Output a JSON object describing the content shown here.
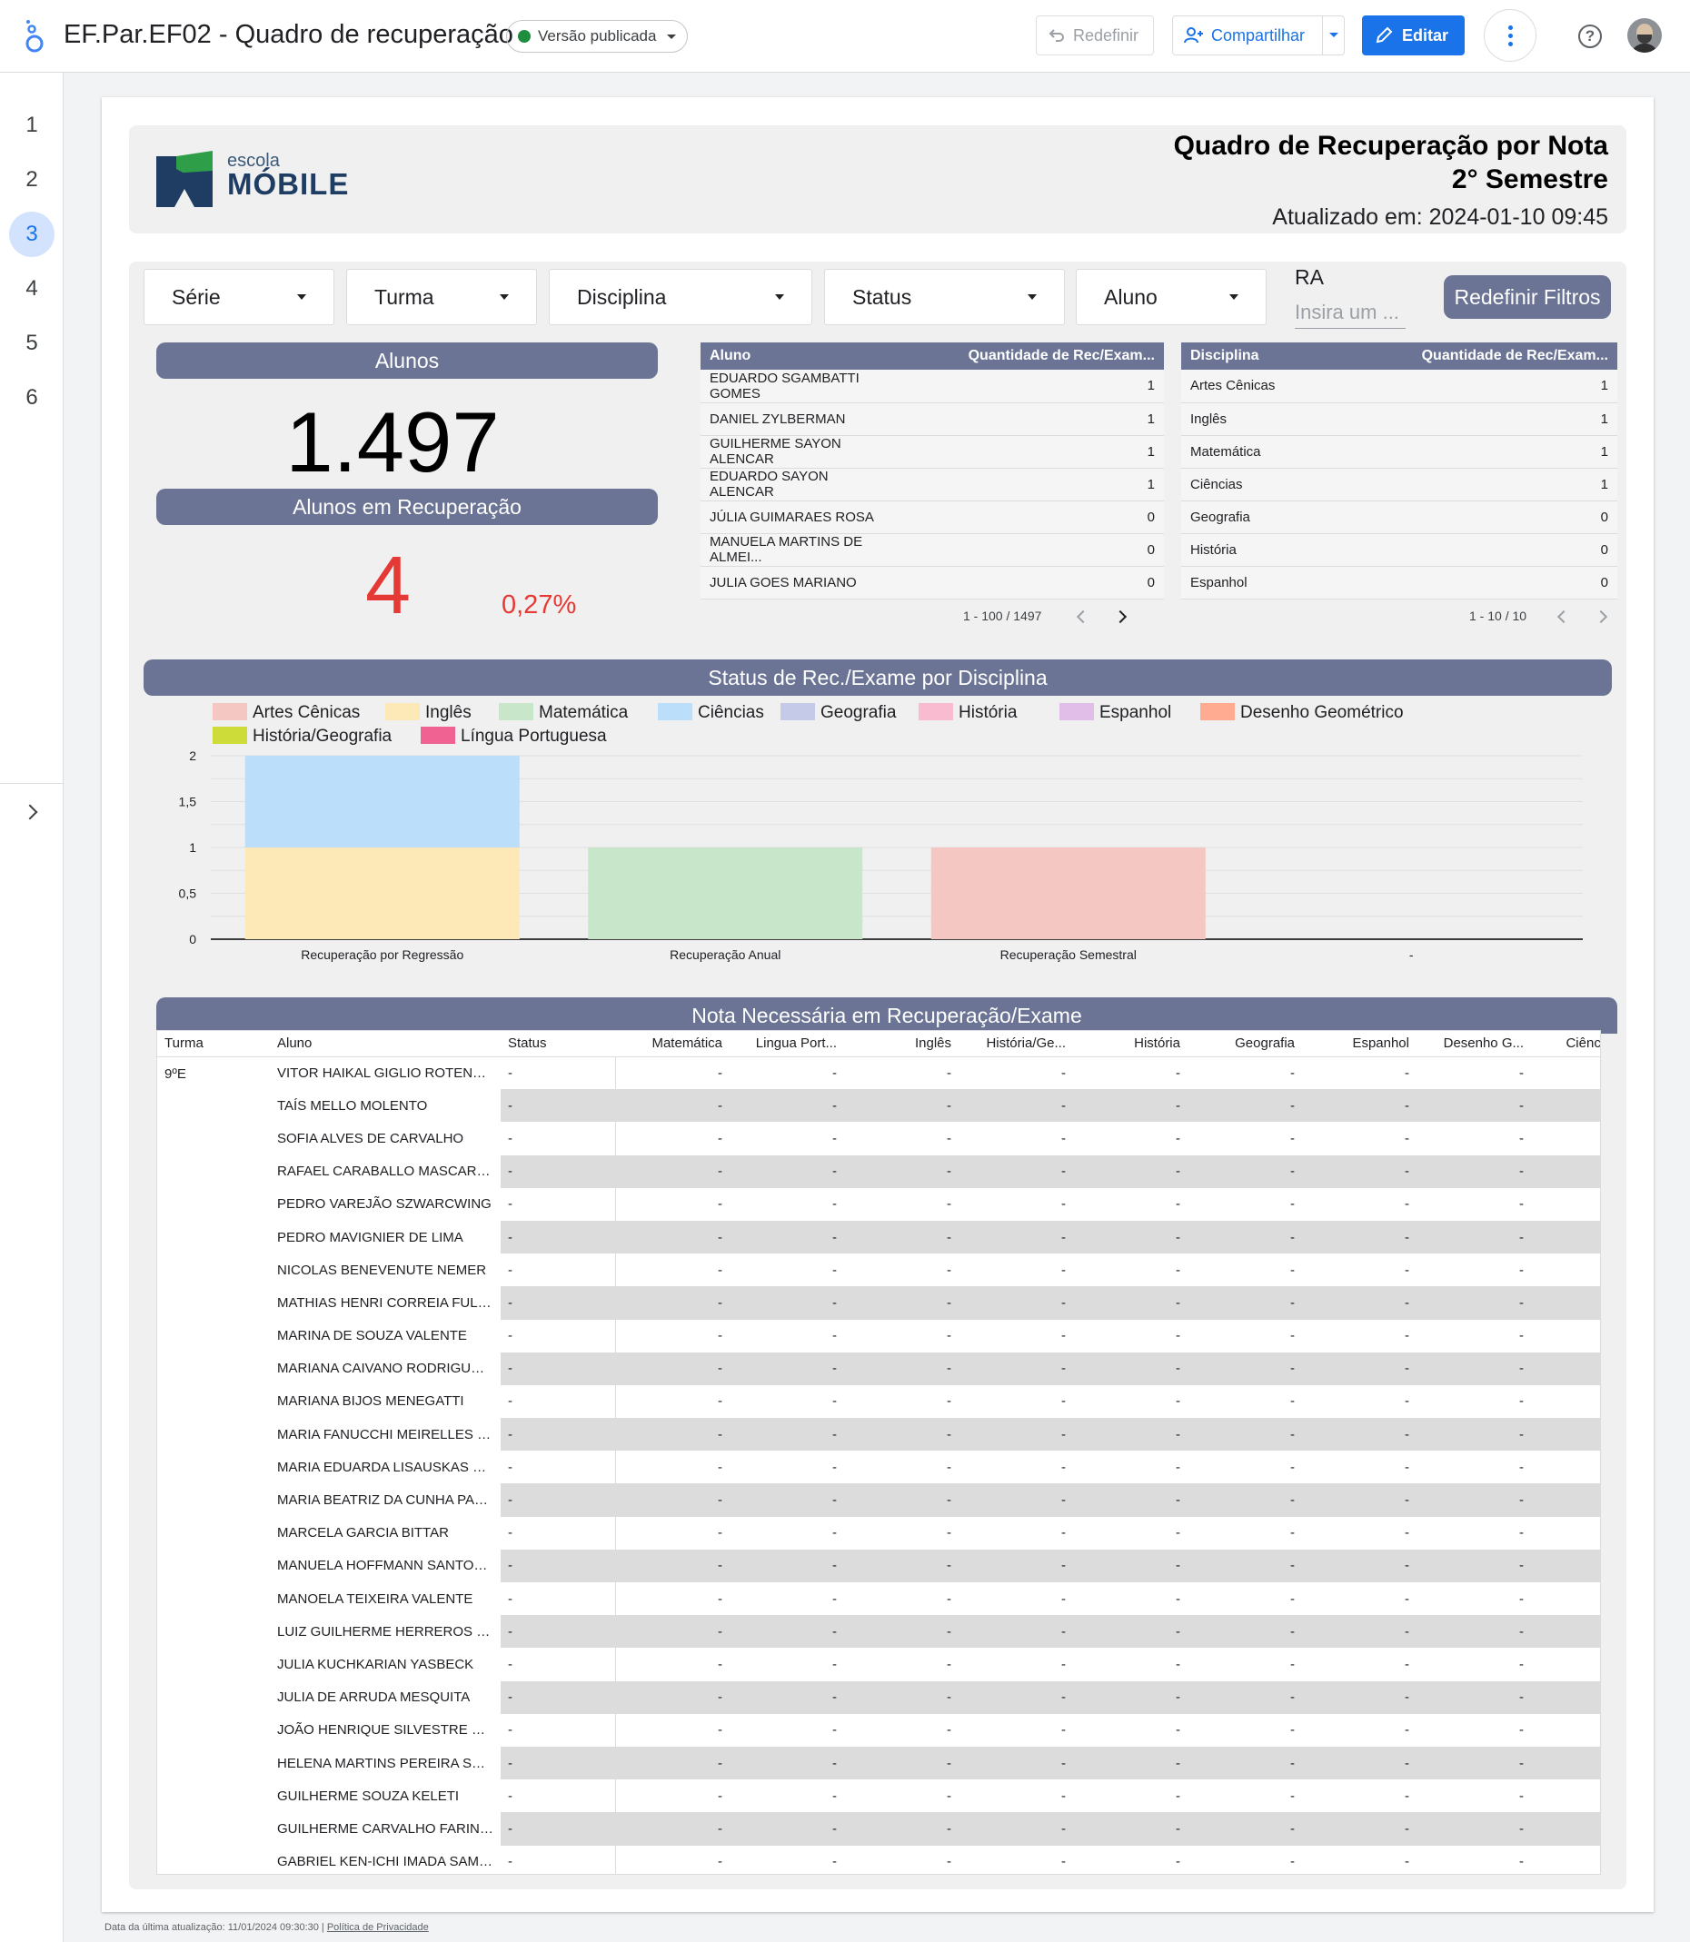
{
  "app": {
    "doc_title": "EF.Par.EF02 - Quadro de recuperação",
    "version_label": "Versão publicada",
    "reset_label": "Redefinir",
    "share_label": "Compartilhar",
    "edit_label": "Editar",
    "help_icon": "help-circle-icon",
    "brand_color": "#1a73e8"
  },
  "pages": [
    "1",
    "2",
    "3",
    "4",
    "5",
    "6"
  ],
  "active_page": "3",
  "report": {
    "brand_top": "escola",
    "brand_bottom": "MÓBILE",
    "title_line1": "Quadro de Recuperação por Nota",
    "title_line2": "2° Semestre",
    "updated": "Atualizado em: 2024-01-10 09:45",
    "accent_color": "#6b7494"
  },
  "filters": {
    "serie": "Série",
    "turma": "Turma",
    "disciplina": "Disciplina",
    "status": "Status",
    "aluno": "Aluno",
    "ra_label": "RA",
    "ra_placeholder": "Insira um ...",
    "reset_button": "Redefinir Filtros"
  },
  "kpis": {
    "alunos_title": "Alunos",
    "alunos_value": "1.497",
    "rec_title": "Alunos em Recuperação",
    "rec_value": "4",
    "rec_pct": "0,27%"
  },
  "students_table": {
    "headers": [
      "Aluno",
      "Quantidade de Rec/Exam..."
    ],
    "rows": [
      [
        "EDUARDO SGAMBATTI GOMES",
        "1"
      ],
      [
        "DANIEL ZYLBERMAN",
        "1"
      ],
      [
        "GUILHERME SAYON ALENCAR",
        "1"
      ],
      [
        "EDUARDO SAYON ALENCAR",
        "1"
      ],
      [
        "JÚLIA GUIMARAES ROSA",
        "0"
      ],
      [
        "MANUELA MARTINS DE ALMEI...",
        "0"
      ],
      [
        "JULIA GOES MARIANO",
        "0"
      ]
    ],
    "pager": "1 - 100 / 1497"
  },
  "subjects_table": {
    "headers": [
      "Disciplina",
      "Quantidade de Rec/Exam..."
    ],
    "rows": [
      [
        "Artes Cênicas",
        "1"
      ],
      [
        "Inglês",
        "1"
      ],
      [
        "Matemática",
        "1"
      ],
      [
        "Ciências",
        "1"
      ],
      [
        "Geografia",
        "0"
      ],
      [
        "História",
        "0"
      ],
      [
        "Espanhol",
        "0"
      ]
    ],
    "pager": "1 - 10 / 10"
  },
  "chart_data": {
    "type": "bar",
    "stacked": true,
    "title": "Status de Rec./Exame por Disciplina",
    "categories": [
      "Recuperação por Regressão",
      "Recuperação Anual",
      "Recuperação Semestral",
      "-"
    ],
    "series": [
      {
        "name": "Artes Cênicas",
        "color": "#f4c7c3",
        "values": [
          0,
          0,
          1,
          0
        ]
      },
      {
        "name": "Inglês",
        "color": "#fde9b8",
        "values": [
          1,
          0,
          0,
          0
        ]
      },
      {
        "name": "Matemática",
        "color": "#c8e6c9",
        "values": [
          0,
          1,
          0,
          0
        ]
      },
      {
        "name": "Ciências",
        "color": "#bbdefb",
        "values": [
          1,
          0,
          0,
          0
        ]
      },
      {
        "name": "Geografia",
        "color": "#c5cae9",
        "values": [
          0,
          0,
          0,
          0
        ]
      },
      {
        "name": "História",
        "color": "#f8bbd0",
        "values": [
          0,
          0,
          0,
          0
        ]
      },
      {
        "name": "Espanhol",
        "color": "#e1bee7",
        "values": [
          0,
          0,
          0,
          0
        ]
      },
      {
        "name": "Desenho Geométrico",
        "color": "#ffab91",
        "values": [
          0,
          0,
          0,
          0
        ]
      },
      {
        "name": "História/Geografia",
        "color": "#cddc39",
        "values": [
          0,
          0,
          0,
          0
        ]
      },
      {
        "name": "Língua Portuguesa",
        "color": "#f06292",
        "values": [
          0,
          0,
          0,
          0
        ]
      }
    ],
    "yticks": [
      "0",
      "0,5",
      "1",
      "1,5",
      "2"
    ],
    "ylim": [
      0,
      2
    ],
    "grid": true,
    "legend": "top"
  },
  "grades_table": {
    "title": "Nota Necessária em Recuperação/Exame",
    "headers": [
      "Turma",
      "Aluno",
      "Status",
      "Matemática",
      "Lingua Port...",
      "Inglês",
      "História/Ge...",
      "História",
      "Geografia",
      "Espanhol",
      "Desenho G...",
      "Ciências"
    ],
    "turma": "9ºE",
    "empty_value": "-",
    "students": [
      "VITOR HAIKAL GIGLIO ROTENBE...",
      "TAÍS MELLO MOLENTO",
      "SOFIA ALVES DE CARVALHO",
      "RAFAEL CARABALLO MASCARETTI",
      "PEDRO VAREJÃO SZWARCWING",
      "PEDRO MAVIGNIER DE LIMA",
      "NICOLAS BENEVENUTE NEMER",
      "MATHIAS HENRI CORREIA FULD...",
      "MARINA DE SOUZA VALENTE",
      "MARIANA CAIVANO RODRIGUES ...",
      "MARIANA BIJOS MENEGATTI",
      "MARIA FANUCCHI MEIRELLES DE...",
      "MARIA EDUARDA LISAUSKAS ZE...",
      "MARIA BEATRIZ DA CUNHA PAC...",
      "MARCELA GARCIA BITTAR",
      "MANUELA HOFFMANN SANTOS ...",
      "MANOELA TEIXEIRA VALENTE",
      "LUIZ GUILHERME HERREROS PINI",
      "JULIA KUCHKARIAN YASBECK",
      "JULIA DE ARRUDA MESQUITA",
      "JOÃO HENRIQUE SILVESTRE ZAN...",
      "HELENA MARTINS PEREIRA SCH...",
      "GUILHERME SOUZA KELETI",
      "GUILHERME CARVALHO FARINA ...",
      "GABRIEL KEN-ICHI IMADA SAMP..."
    ]
  },
  "footer": {
    "last_update": "Data da última atualização: 11/01/2024 09:30:30",
    "separator": "|",
    "privacy": "Política de Privacidade"
  }
}
